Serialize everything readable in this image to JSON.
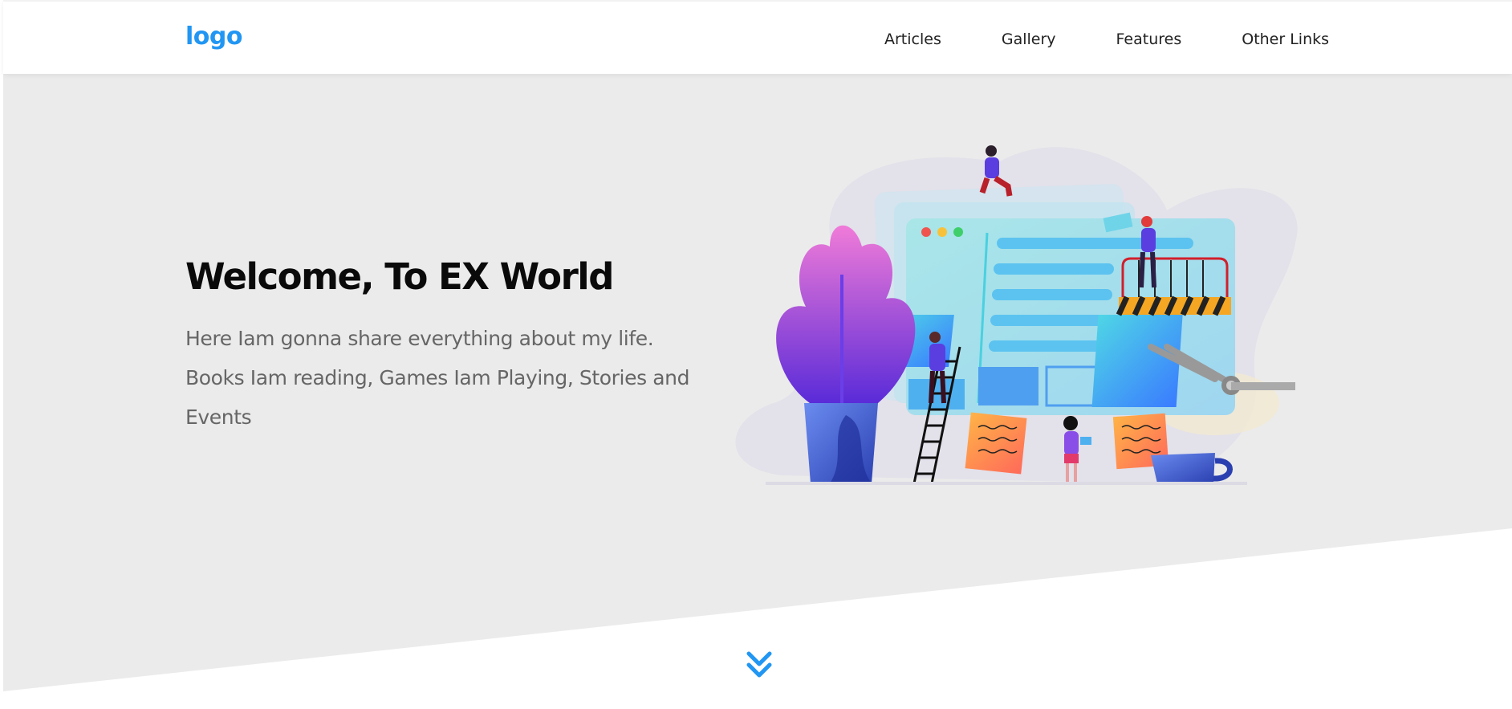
{
  "header": {
    "logo": "logo",
    "nav": {
      "articles": "Articles",
      "gallery": "Gallery",
      "features": "Features",
      "other_links": "Other Links"
    }
  },
  "hero": {
    "title": "Welcome, To EX World",
    "description": "Here Iam gonna share everything about my life. Books Iam reading, Games Iam Playing, Stories and Events",
    "illustration_icon": "website-building-illustration",
    "scroll_icon": "double-chevron-down-icon"
  },
  "colors": {
    "accent": "#2196f3",
    "hero_background": "#ebebeb",
    "text_dark": "#0a0a0a",
    "text_muted": "#666666"
  }
}
